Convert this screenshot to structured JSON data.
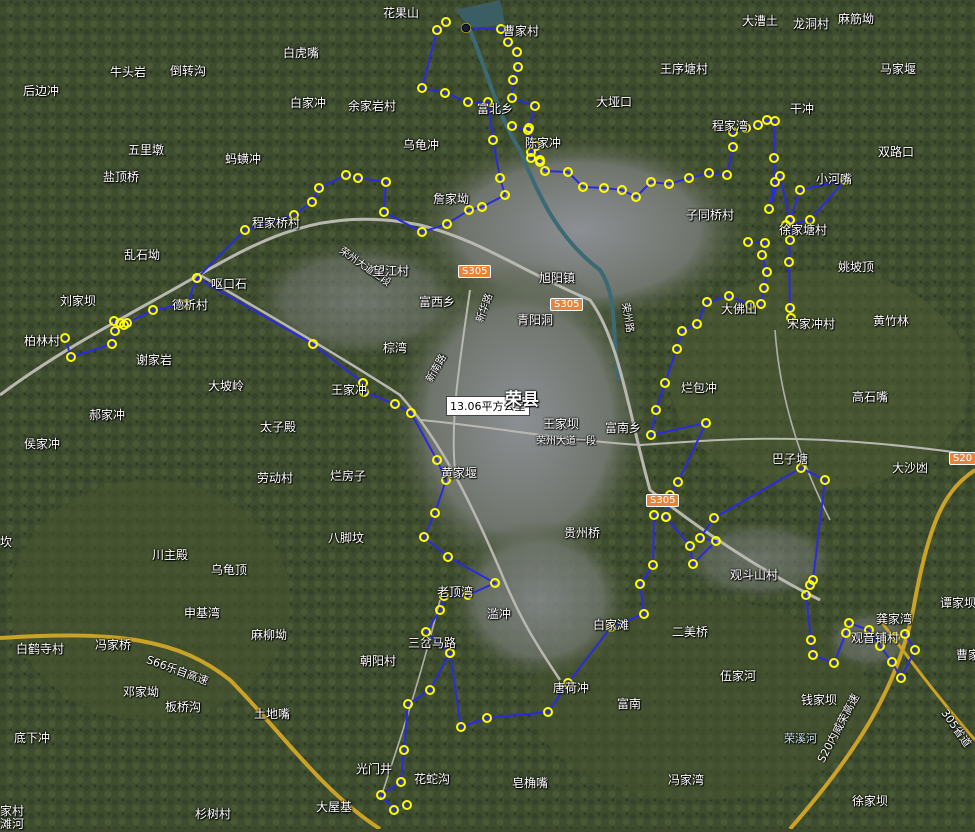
{
  "area_label": "13.06平方公里",
  "city_label": "荣县",
  "colors": {
    "boundary": "#2b2bdc",
    "vertex_fill": "#ffff00",
    "vertex_stroke": "#3a3a00",
    "highway": "#c9a227",
    "road": "#b8b8b0",
    "river": "#3c6a74",
    "route_shield": "#e8843a"
  },
  "routes": [
    "S305",
    "S305",
    "S305",
    "S20"
  ],
  "road_labels": [
    "荣州大道三段",
    "荣州大道一段",
    "荣州路",
    "新华路",
    "新南路",
    "S66乐自高速",
    "S20内威荣高速",
    "305省道",
    "荣溪河"
  ],
  "places": [
    "花果山",
    "曹家村",
    "大漕土",
    "龙洞村",
    "麻筋坳",
    "马家堰",
    "牛头岩",
    "倒转沟",
    "白虎嘴",
    "后边冲",
    "王序塘村",
    "白家冲",
    "余家岩村",
    "富北乡",
    "大垭口",
    "干冲",
    "程家湾",
    "五里墩",
    "乌龟冲",
    "陈家冲",
    "双路口",
    "盐顶桥",
    "蚂蟥冲",
    "小河嘴",
    "詹家坳",
    "子同桥村",
    "程家桥村",
    "徐家塘村",
    "乱石坳",
    "望江村",
    "旭阳镇",
    "姚坡顶",
    "刘家坝",
    "呕口石",
    "德析村",
    "富西乡",
    "青阳洞",
    "大佛山",
    "宋家冲村",
    "黄竹林",
    "柏林村",
    "谢家岩",
    "棕湾",
    "大坡岭",
    "王家冲",
    "烂包冲",
    "高石嘴",
    "郝家冲",
    "太子殿",
    "王家坝",
    "富南乡",
    "侯家冲",
    "巴子塘",
    "大沙凼",
    "劳动村",
    "烂房子",
    "黄家堰",
    "八脚坟",
    "贵州桥",
    "坎",
    "川主殿",
    "乌龟顶",
    "观斗山村",
    "申基湾",
    "老顶湾",
    "龚家湾",
    "谭家坝",
    "白鹤寺村",
    "冯家桥",
    "麻柳坳",
    "滥冲",
    "三岔马路",
    "二美桥",
    "白家滩",
    "朝阳村",
    "观音铺村",
    "曹家",
    "邓家坳",
    "伍家河",
    "板桥沟",
    "唐荷冲",
    "富南",
    "土地嘴",
    "钱家坝",
    "底下冲",
    "光门井",
    "花蛇沟",
    "皂桷嘴",
    "冯家湾",
    "杉树村",
    "大屋基",
    "徐家坝",
    "家村",
    "滩河"
  ]
}
